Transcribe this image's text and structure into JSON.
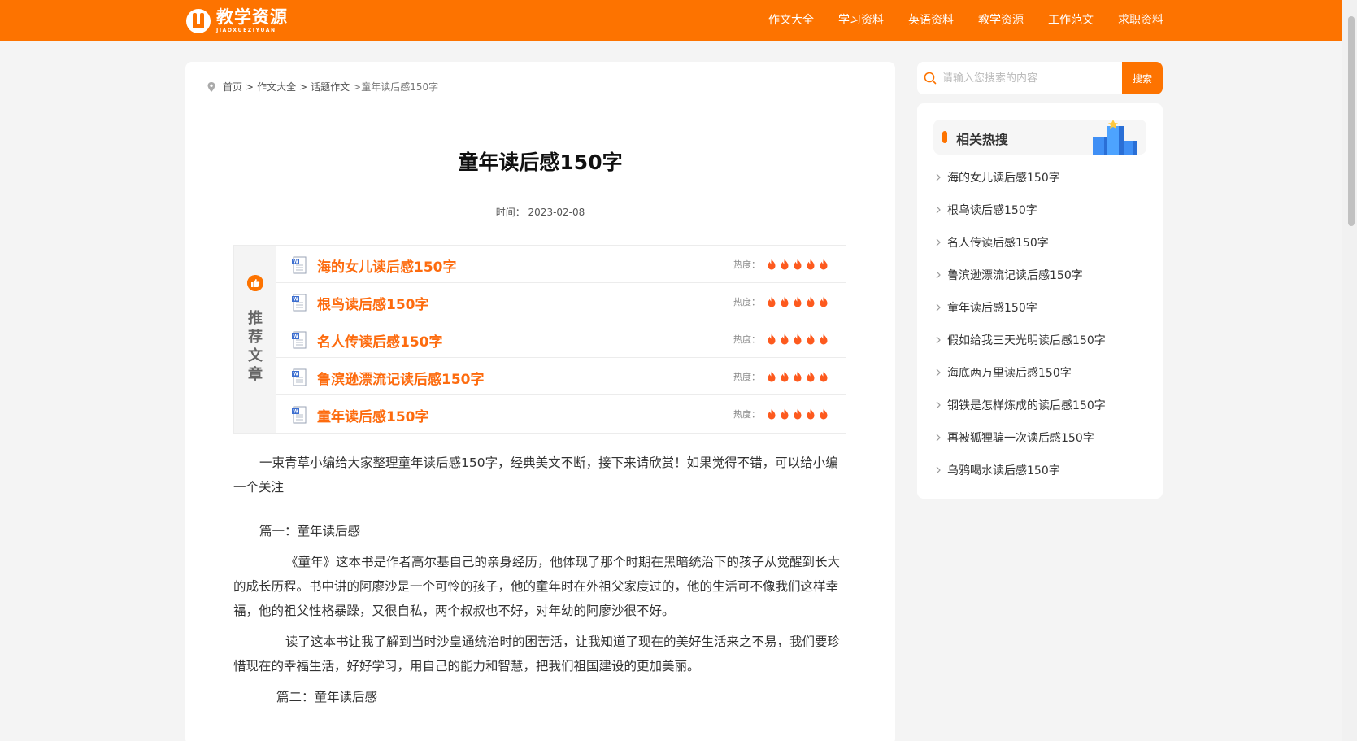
{
  "header": {
    "logo_title": "教学资源",
    "logo_subtitle": "JIAOXUEZIYUAN",
    "nav": [
      "作文大全",
      "学习资料",
      "英语资料",
      "教学资源",
      "工作范文",
      "求职资料"
    ]
  },
  "breadcrumb": {
    "home": "首页",
    "level1": "作文大全",
    "level2": "话题作文",
    "sep": ">",
    "current": ">童年读后感150字"
  },
  "article": {
    "title": "童年读后感150字",
    "time_label": "时间：",
    "time": "2023-02-08"
  },
  "recommend": {
    "label": "推荐文章",
    "heat_label": "热度：",
    "heat_level": 5,
    "items": [
      "海的女儿读后感150字",
      "根鸟读后感150字",
      "名人传读后感150字",
      "鲁滨逊漂流记读后感150字",
      "童年读后感150字"
    ]
  },
  "content": {
    "intro": "一束青草小编给大家整理童年读后感150字，经典美文不断，接下来请欣赏！如果觉得不错，可以给小编一个关注",
    "section1_head": "篇一：童年读后感",
    "section1_p1": "《童年》这本书是作者高尔基自己的亲身经历，他体现了那个时期在黑暗统治下的孩子从觉醒到长大的成长历程。书中讲的阿廖沙是一个可怜的孩子，他的童年时在外祖父家度过的，他的生活可不像我们这样幸福，他的祖父性格暴躁，又很自私，两个叔叔也不好，对年幼的阿廖沙很不好。",
    "section1_p2": "读了这本书让我了解到当时沙皇通统治时的困苦活，让我知道了现在的美好生活来之不易，我们要珍惜现在的幸福生活，好好学习，用自己的能力和智慧，把我们祖国建设的更加美丽。",
    "section2_head": "篇二：童年读后感"
  },
  "search": {
    "placeholder": "请输入您搜索的内容",
    "button": "搜索"
  },
  "hot": {
    "title": "相关热搜",
    "items": [
      "海的女儿读后感150字",
      "根鸟读后感150字",
      "名人传读后感150字",
      "鲁滨逊漂流记读后感150字",
      "童年读后感150字",
      "假如给我三天光明读后感150字",
      "海底两万里读后感150字",
      "钢铁是怎样炼成的读后感150字",
      "再被狐狸骗一次读后感150字",
      "乌鸦喝水读后感150字"
    ]
  },
  "colors": {
    "brand": "#fd7300",
    "link": "#fd6b0e"
  }
}
